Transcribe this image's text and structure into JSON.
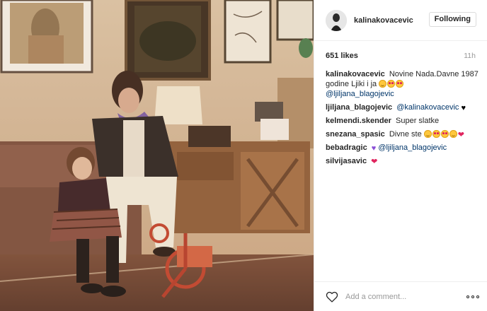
{
  "header": {
    "username": "kalinakovacevic",
    "follow_label": "Following"
  },
  "meta": {
    "likes": "651 likes",
    "time": "11h"
  },
  "comments": [
    {
      "author": "kalinakovacevic",
      "text": "Novine Nada.Davne 1987 godine Ljiki i ja",
      "emojis": [
        "smile",
        "heart-eyes",
        "heart-eyes"
      ],
      "mention": "@ljiljana_blagojevic"
    },
    {
      "author": "ljiljana_blagojevic",
      "mention": "@kalinakovacevic",
      "suffix": "black-heart"
    },
    {
      "author": "kelmendi.skender",
      "text": "Super slatke"
    },
    {
      "author": "snezana_spasic",
      "text": "Divne ste",
      "emojis": [
        "smile",
        "heart-eyes",
        "heart-eyes",
        "smile"
      ],
      "suffix": "red-heart"
    },
    {
      "author": "bebadragic",
      "prefix": "purple-heart",
      "mention": "@ljiljana_blagojevic"
    },
    {
      "author": "silvijasavic",
      "suffix": "red-heart"
    }
  ],
  "actions": {
    "comment_placeholder": "Add a comment...",
    "like_icon": "heart-outline-icon",
    "more_icon": "more-options-icon"
  },
  "colors": {
    "mention": "#003569",
    "border": "#efefef",
    "muted": "#999999"
  }
}
